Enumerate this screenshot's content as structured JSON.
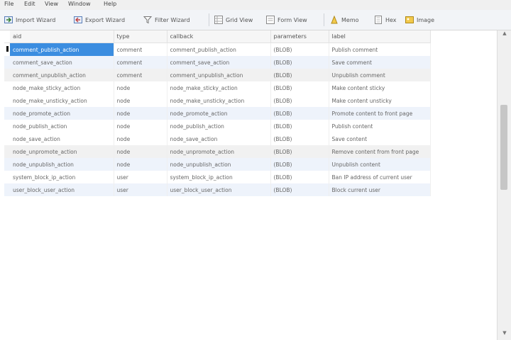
{
  "menu": [
    "File",
    "Edit",
    "View",
    "Window",
    "Help"
  ],
  "toolbar": {
    "import_wizard": "Import Wizard",
    "export_wizard": "Export Wizard",
    "filter_wizard": "Filter Wizard",
    "grid_view": "Grid View",
    "form_view": "Form View",
    "memo": "Memo",
    "hex": "Hex",
    "image": "Image"
  },
  "grid": {
    "columns": [
      "aid",
      "type",
      "callback",
      "parameters",
      "label"
    ],
    "rows": [
      [
        "comment_publish_action",
        "comment",
        "comment_publish_action",
        "(BLOB)",
        "Publish comment"
      ],
      [
        "comment_save_action",
        "comment",
        "comment_save_action",
        "(BLOB)",
        "Save comment"
      ],
      [
        "comment_unpublish_action",
        "comment",
        "comment_unpublish_action",
        "(BLOB)",
        "Unpublish comment"
      ],
      [
        "node_make_sticky_action",
        "node",
        "node_make_sticky_action",
        "(BLOB)",
        "Make content sticky"
      ],
      [
        "node_make_unsticky_action",
        "node",
        "node_make_unsticky_action",
        "(BLOB)",
        "Make content unsticky"
      ],
      [
        "node_promote_action",
        "node",
        "node_promote_action",
        "(BLOB)",
        "Promote content to front page"
      ],
      [
        "node_publish_action",
        "node",
        "node_publish_action",
        "(BLOB)",
        "Publish content"
      ],
      [
        "node_save_action",
        "node",
        "node_save_action",
        "(BLOB)",
        "Save content"
      ],
      [
        "node_unpromote_action",
        "node",
        "node_unpromote_action",
        "(BLOB)",
        "Remove content from front page"
      ],
      [
        "node_unpublish_action",
        "node",
        "node_unpublish_action",
        "(BLOB)",
        "Unpublish content"
      ],
      [
        "system_block_ip_action",
        "user",
        "system_block_ip_action",
        "(BLOB)",
        "Ban IP address of current user"
      ],
      [
        "user_block_user_action",
        "user",
        "user_block_user_action",
        "(BLOB)",
        "Block current user"
      ]
    ]
  },
  "colors": {
    "selection": "#3b8de0",
    "alt_row": "#eef3fb",
    "header_bg": "#f6f6f6"
  }
}
